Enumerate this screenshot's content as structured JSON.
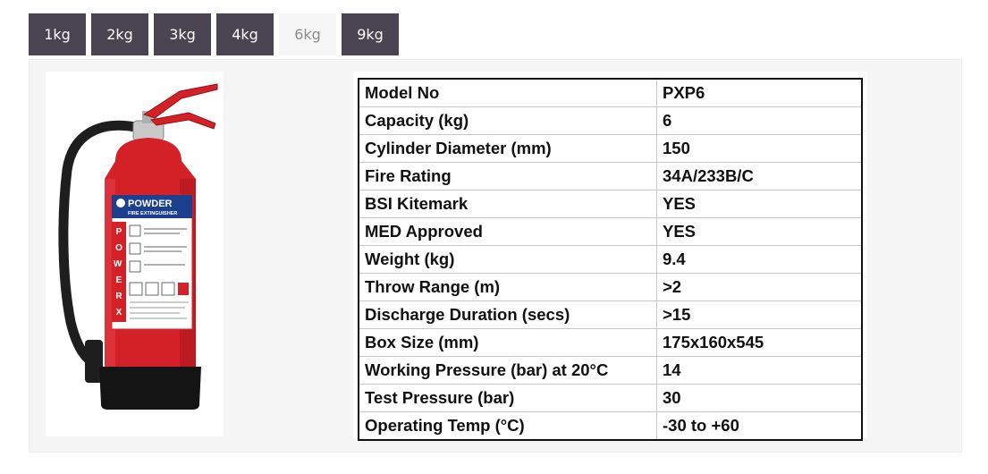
{
  "tabs": [
    "1kg",
    "2kg",
    "3kg",
    "4kg",
    "6kg",
    "9kg"
  ],
  "active_tab": "6kg",
  "product": {
    "label_brand": "POWDER",
    "label_sub": "FIRE EXTINGUISHER",
    "label_vertical": "POWERX"
  },
  "specs": [
    {
      "label": "Model No",
      "value": "PXP6"
    },
    {
      "label": "Capacity (kg)",
      "value": "6"
    },
    {
      "label": "Cylinder Diameter (mm)",
      "value": "150"
    },
    {
      "label": "Fire Rating",
      "value": "34A/233B/C"
    },
    {
      "label": "BSI Kitemark",
      "value": "YES"
    },
    {
      "label": "MED Approved",
      "value": "YES"
    },
    {
      "label": "Weight (kg)",
      "value": "9.4"
    },
    {
      "label": "Throw Range (m)",
      "value": ">2"
    },
    {
      "label": "Discharge Duration (secs)",
      "value": ">15"
    },
    {
      "label": "Box Size (mm)",
      "value": "175x160x545"
    },
    {
      "label": "Working Pressure (bar) at 20°C",
      "value": "14"
    },
    {
      "label": "Test Pressure (bar)",
      "value": "30"
    },
    {
      "label": "Operating Temp (°C)",
      "value": "-30 to +60"
    }
  ],
  "colors": {
    "tab_bg": "#4a4352",
    "tab_active_bg": "#f6f6f6",
    "panel_bg": "#f5f5f5",
    "extinguisher_red": "#d42027",
    "label_blue": "#1d3f8f"
  }
}
